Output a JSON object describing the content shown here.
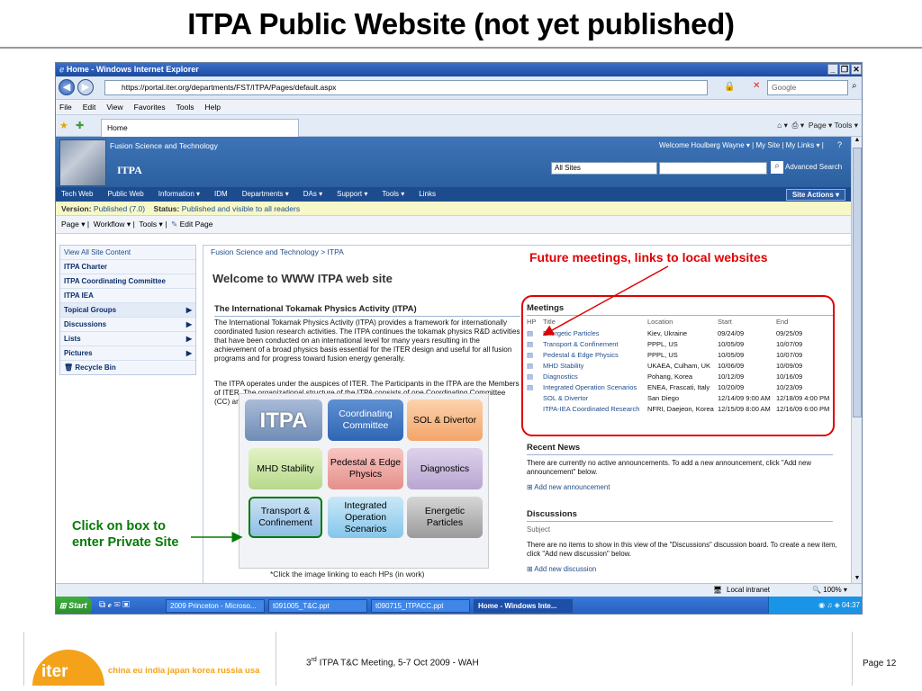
{
  "slide": {
    "title": "ITPA Public Website (not yet published)",
    "footer_meeting": "ITPA T&C Meeting, 5-7 Oct 2009 - WAH",
    "footer_meeting_prefix": "3",
    "footer_meeting_sup": "rd",
    "page": "Page 12",
    "logo_text": "iter",
    "members": "china eu india japan korea russia usa"
  },
  "annotations": {
    "future_meetings": "Future meetings, links to local websites",
    "click_box_line1": "Click on box to",
    "click_box_line2": "enter Private Site"
  },
  "browser": {
    "window_title": "Home - Windows Internet Explorer",
    "url": "https://portal.iter.org/departments/FST/ITPA/Pages/default.aspx",
    "search_placeholder": "Google",
    "menu": [
      "File",
      "Edit",
      "View",
      "Favorites",
      "Tools",
      "Help"
    ],
    "tab_label": "Home",
    "right_tools": "Page ▾   Tools ▾",
    "status_zone": "Local intranet",
    "zoom": "100%"
  },
  "sharepoint": {
    "site_parent": "Fusion Science and Technology",
    "site_name": "ITPA",
    "welcome_user": "Welcome Houlberg Wayne ▾  |  My Site  |  My Links ▾  |",
    "scope": "All Sites",
    "advanced_search": "Advanced Search",
    "topnav": [
      "Tech Web",
      "Public Web",
      "Information ▾",
      "IDM",
      "Departments ▾",
      "DAs ▾",
      "Support ▾",
      "Tools ▾",
      "Links"
    ],
    "site_actions": "Site Actions ▾",
    "version_label": "Version:",
    "version_value": "Published (7.0)",
    "status_label": "Status:",
    "status_value": "Published and visible to all readers",
    "toolbar": [
      "Page ▾",
      "Workflow ▾",
      "Tools ▾",
      "Edit Page"
    ],
    "leftnav": [
      {
        "label": "View All Site Content"
      },
      {
        "label": "ITPA Charter"
      },
      {
        "label": "ITPA Coordinating Committee"
      },
      {
        "label": "ITPA IEA"
      },
      {
        "label": "Topical Groups"
      },
      {
        "label": "Discussions"
      },
      {
        "label": "Lists"
      },
      {
        "label": "Pictures"
      },
      {
        "label": "Recycle Bin"
      }
    ],
    "breadcrumb": "Fusion Science and Technology > ITPA",
    "welcome_heading": "Welcome to WWW ITPA web site",
    "itpa_heading": "The International Tokamak Physics Activity (ITPA)",
    "para1": "The International Tokamak Physics Activity (ITPA) provides a framework for internationally coordinated fusion research activities.  The ITPA continues the tokamak physics R&D activities that have been conducted on an international level for many years resulting in the achievement of a broad physics basis essential for the ITER design and useful for all fusion programs and for progress toward fusion energy generally.",
    "para2": "The ITPA operates under the auspices of ITER. The Participants in the ITPA are the Members of ITER. The organizational structure of the ITPA consists of one Coordinating Committee (CC) and several Topical Physics Groups.",
    "diagram": {
      "itpa": "ITPA",
      "cc": "Coordinating Committee",
      "sol": "SOL & Divertor",
      "mhd": "MHD Stability",
      "ped": "Pedestal & Edge Physics",
      "diag": "Diagnostics",
      "tc": "Transport & Confinement",
      "ios": "Integrated Operation Scenarios",
      "ep": "Energetic Particles",
      "caption": "*Click the image linking to each HPs (in work)"
    },
    "meetings": {
      "heading": "Meetings",
      "cols": [
        "HP",
        "Title",
        "Location",
        "Start",
        "End"
      ],
      "rows": [
        {
          "title": "Energetic Particles",
          "location": "Kiev, Ukraine",
          "start": "09/24/09",
          "end": "09/25/09"
        },
        {
          "title": "Transport & Confinement",
          "location": "PPPL, US",
          "start": "10/05/09",
          "end": "10/07/09"
        },
        {
          "title": "Pedestal & Edge Physics",
          "location": "PPPL, US",
          "start": "10/05/09",
          "end": "10/07/09"
        },
        {
          "title": "MHD Stability",
          "location": "UKAEA, Culham, UK",
          "start": "10/06/09",
          "end": "10/09/09"
        },
        {
          "title": "Diagnostics",
          "location": "Pohang, Korea",
          "start": "10/12/09",
          "end": "10/16/09"
        },
        {
          "title": "Integrated Operation Scenarios",
          "location": "ENEA, Frascati, Italy",
          "start": "10/20/09",
          "end": "10/23/09"
        },
        {
          "title": "SOL & Divertor",
          "location": "San Diego",
          "start": "12/14/09 9:00 AM",
          "end": "12/18/09 4:00 PM"
        },
        {
          "title": "ITPA-IEA Coordinated Research",
          "location": "NFRI, Daejeon, Korea",
          "start": "12/15/09 8:00 AM",
          "end": "12/16/09 6:00 PM"
        }
      ]
    },
    "news": {
      "heading": "Recent News",
      "text": "There are currently no active announcements. To add a new announcement, click \"Add new announcement\" below.",
      "add": "Add new announcement"
    },
    "discussions": {
      "heading": "Discussions",
      "col": "Subject",
      "text": "There are no items to show in this view of the \"Discussions\" discussion board. To create a new item, click \"Add new discussion\" below.",
      "add": "Add new discussion"
    }
  },
  "taskbar": {
    "start": "Start",
    "items": [
      "2009 Princeton - Microso...",
      "t091005_T&C.ppt",
      "t090715_ITPACC.ppt",
      "Home - Windows Inte..."
    ],
    "clock": "04:37"
  },
  "colors": {
    "annotation_red": "#e00000",
    "annotation_green": "#067a06",
    "sharepoint_blue": "#2b5f9f"
  }
}
